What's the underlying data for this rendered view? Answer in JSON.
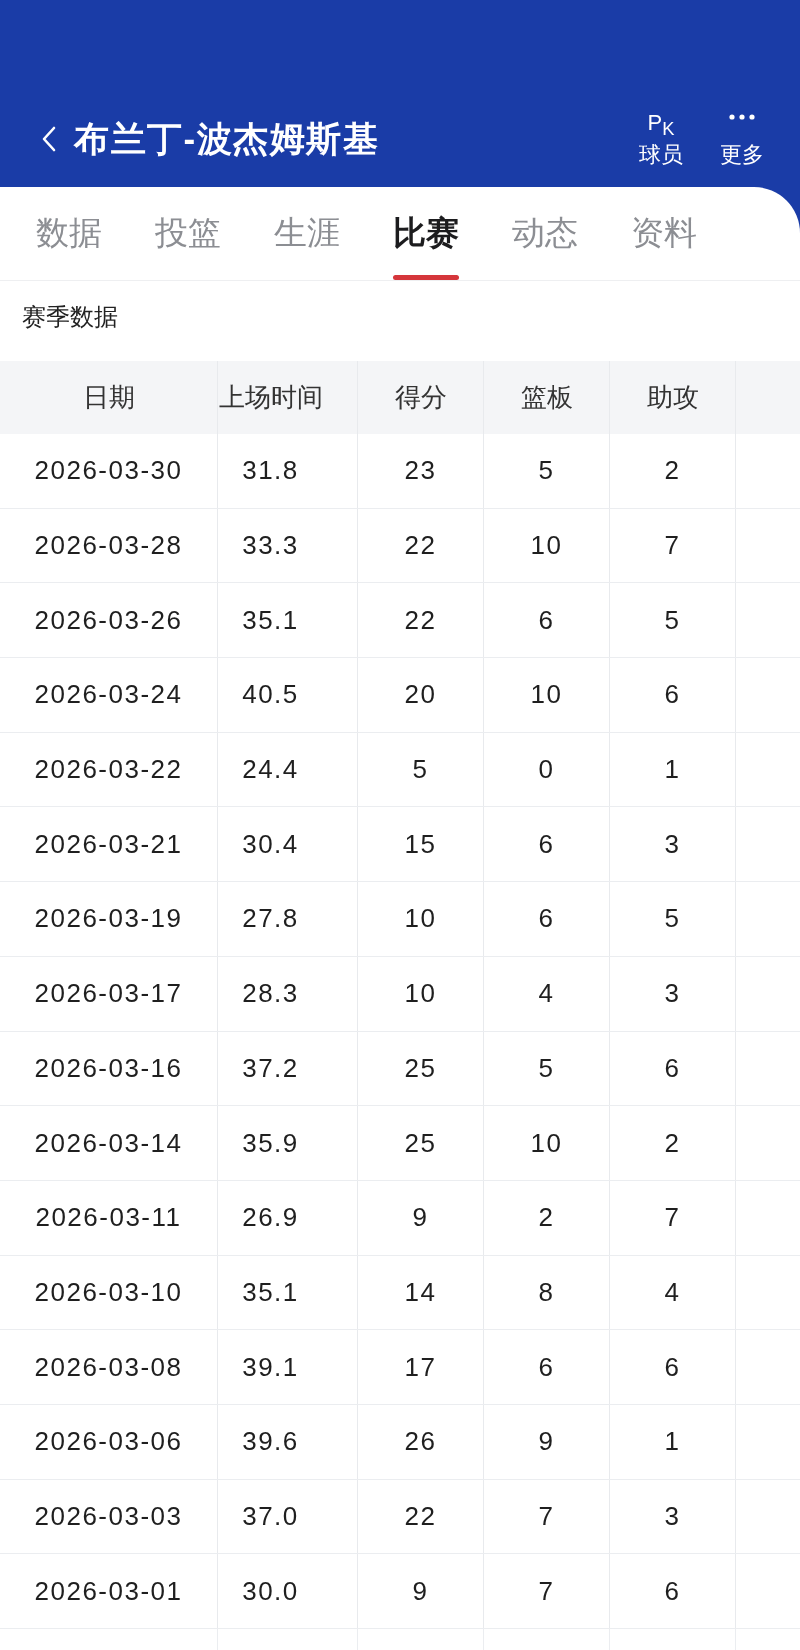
{
  "header": {
    "title": "布兰丁-波杰姆斯基",
    "actions": [
      {
        "kind": "pk",
        "icon_text": "P$_{K}$",
        "label": "球员"
      },
      {
        "kind": "more",
        "label": "更多"
      }
    ]
  },
  "tabs": [
    {
      "label": "数据",
      "selected": false
    },
    {
      "label": "投篮",
      "selected": false
    },
    {
      "label": "生涯",
      "selected": false
    },
    {
      "label": "比赛",
      "selected": true
    },
    {
      "label": "动态",
      "selected": false
    },
    {
      "label": "资料",
      "selected": false
    }
  ],
  "section_title": "赛季数据",
  "table": {
    "columns": [
      "日期",
      "上场时间",
      "得分",
      "篮板",
      "助攻"
    ],
    "rows": [
      [
        "2026-03-30",
        "31.8",
        "23",
        "5",
        "2"
      ],
      [
        "2026-03-28",
        "33.3",
        "22",
        "10",
        "7"
      ],
      [
        "2026-03-26",
        "35.1",
        "22",
        "6",
        "5"
      ],
      [
        "2026-03-24",
        "40.5",
        "20",
        "10",
        "6"
      ],
      [
        "2026-03-22",
        "24.4",
        "5",
        "0",
        "1"
      ],
      [
        "2026-03-21",
        "30.4",
        "15",
        "6",
        "3"
      ],
      [
        "2026-03-19",
        "27.8",
        "10",
        "6",
        "5"
      ],
      [
        "2026-03-17",
        "28.3",
        "10",
        "4",
        "3"
      ],
      [
        "2026-03-16",
        "37.2",
        "25",
        "5",
        "6"
      ],
      [
        "2026-03-14",
        "35.9",
        "25",
        "10",
        "2"
      ],
      [
        "2026-03-11",
        "26.9",
        "9",
        "2",
        "7"
      ],
      [
        "2026-03-10",
        "35.1",
        "14",
        "8",
        "4"
      ],
      [
        "2026-03-08",
        "39.1",
        "17",
        "6",
        "6"
      ],
      [
        "2026-03-06",
        "39.6",
        "26",
        "9",
        "1"
      ],
      [
        "2026-03-03",
        "37.0",
        "22",
        "7",
        "3"
      ],
      [
        "2026-03-01",
        "30.0",
        "9",
        "7",
        "6"
      ]
    ]
  }
}
